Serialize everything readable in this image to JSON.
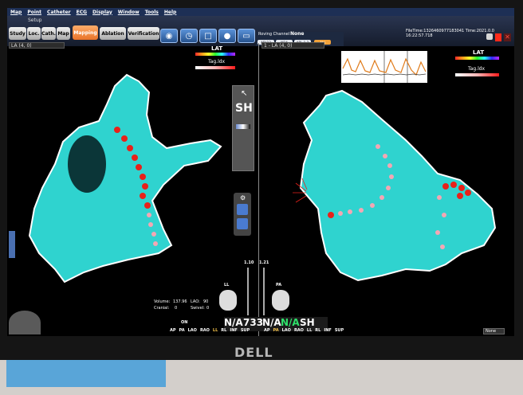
{
  "menu": [
    "Map",
    "Point",
    "Catheter",
    "ECG",
    "Display",
    "Window",
    "Tools",
    "Help"
  ],
  "toolbar": {
    "setup_label": "Setup",
    "tabs": [
      "Study",
      "Loc.",
      "Cath.",
      "Map",
      "Mapping",
      "Ablation",
      "Verification"
    ],
    "active_tab": "Mapping"
  },
  "roving": {
    "title": "Roving Channel",
    "value": "None",
    "chips": [
      "ABL12",
      "M34",
      "ABL 1-2",
      "Abl"
    ]
  },
  "file_time": "FileTime:1326460977183041 Time:2021.0.0 16:22:57.718",
  "left_panel": {
    "view": "LA (4, 0)",
    "lat_label": "LAT",
    "tag_label": "Tag.ldx",
    "sh_label": "SH",
    "volume_label": "Volume:",
    "volume_value": "137.96",
    "cranial_label": "Cranial:",
    "cranial_value": "0",
    "lao_label": "LAO:",
    "lao_value": "90",
    "swivel_label": "Swivel:",
    "swivel_value": "0",
    "on_label": "ON",
    "buttons": [
      "AP",
      "PA",
      "LAO",
      "RAO",
      "LL",
      "RL",
      "INF",
      "SUP"
    ],
    "na_value": "N/A",
    "num_value": "733",
    "orient_label": "LL",
    "slider_value": "1.10"
  },
  "right_panel": {
    "view": "1 - LA (4, 0)",
    "lat_label": "LAT",
    "tag_label": "Tag.ldx",
    "sh_label": "SH",
    "buttons": [
      "AP",
      "PA",
      "LAO",
      "RAO",
      "LL",
      "RL",
      "INF",
      "SUP"
    ],
    "na_value": "N/A",
    "na_value_2": "N/A",
    "sh_value": "SH",
    "off_label": "ON",
    "orient_label": "PA",
    "slider_value": "1.21",
    "none_select": "None"
  },
  "colors": {
    "map_fill": "#2fd3cf",
    "ablation_point": "#e8211a",
    "tag_point": "#f3a7b4",
    "active_tab": "#f08a3a"
  },
  "monitor_brand": "DELL"
}
